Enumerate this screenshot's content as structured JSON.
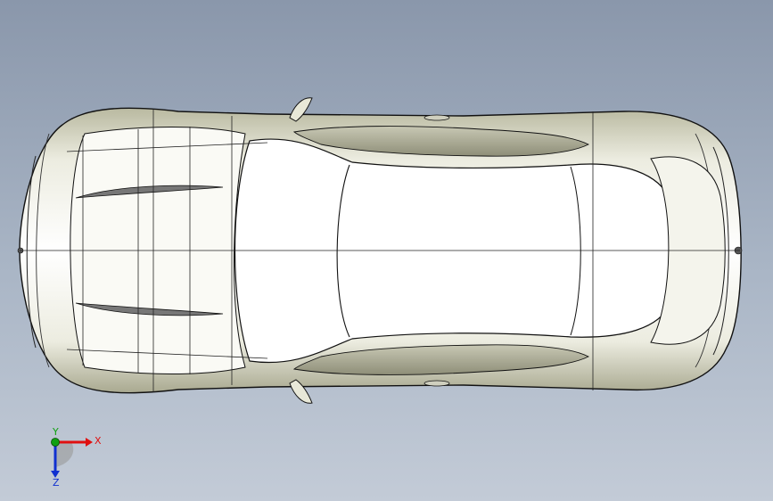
{
  "viewport": {
    "background_top": "#8a97ab",
    "background_bottom": "#c3cbd7",
    "model_fill": "#ffffff",
    "model_shade": "#d9d9c4",
    "edge_color": "#111111"
  },
  "triad": {
    "x_label": "X",
    "y_label": "Y",
    "z_label": "Z",
    "x_color": "#e01010",
    "y_color": "#10a010",
    "z_color": "#1030d0"
  }
}
